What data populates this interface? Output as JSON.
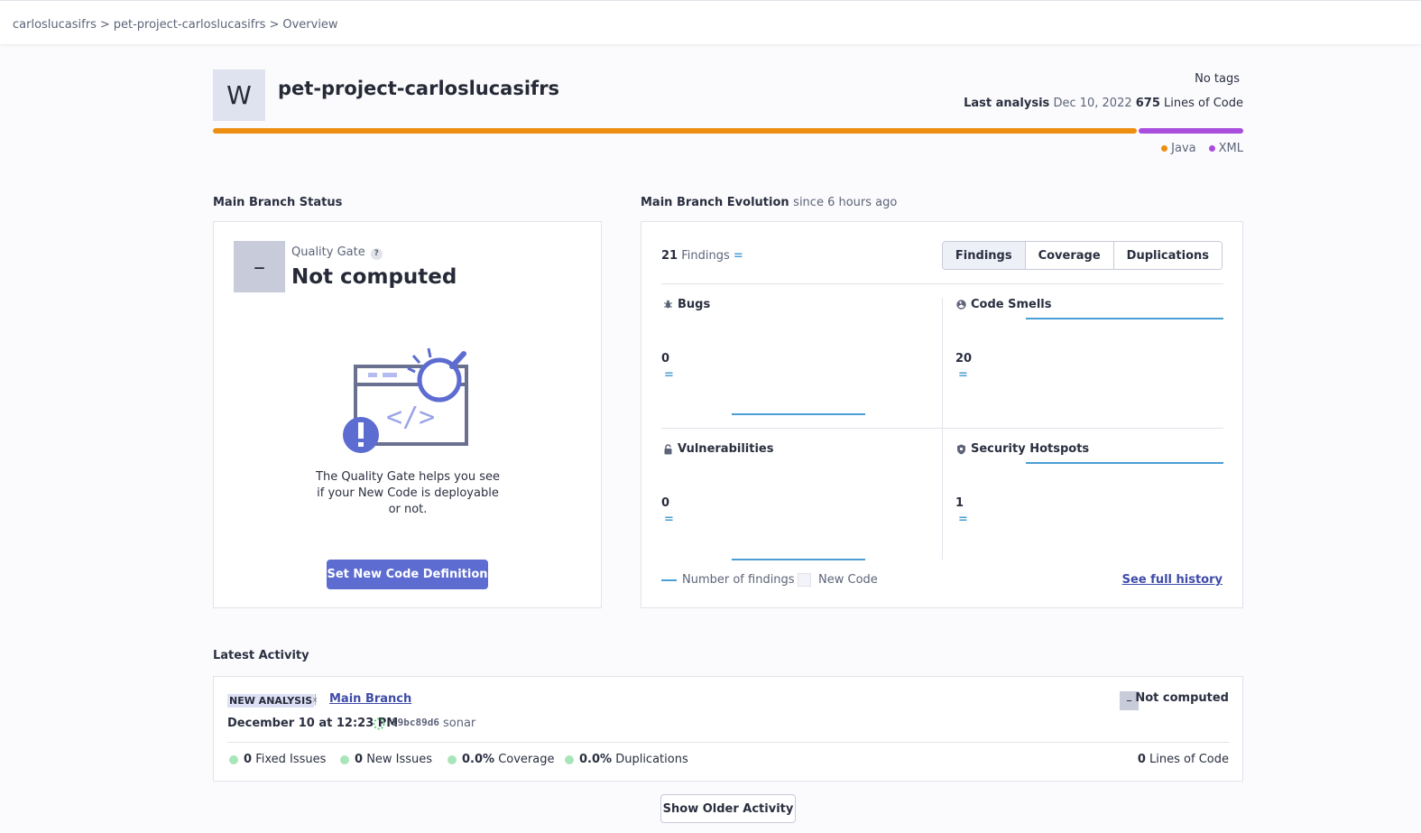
{
  "breadcrumb": {
    "items": [
      "carloslucasifrs",
      "pet-project-carloslucasifrs",
      "Overview"
    ],
    "separator": ">"
  },
  "project": {
    "avatar_letter": "W",
    "name": "pet-project-carloslucasifrs",
    "tags": "No tags",
    "last_analysis_label": "Last analysis",
    "last_analysis_date": "Dec 10, 2022",
    "loc_count": "675",
    "loc_label": "Lines of Code"
  },
  "languages": [
    {
      "name": "Java",
      "color": "#ed8e11",
      "fraction": 0.898
    },
    {
      "name": "XML",
      "color": "#a94ddc",
      "fraction": 0.102
    }
  ],
  "main_status": {
    "section_title": "Main Branch Status",
    "qg_symbol": "–",
    "qg_label": "Quality Gate",
    "qg_help": "?",
    "qg_value": "Not computed",
    "description": "The Quality Gate helps you see if your New Code is deployable or not.",
    "button_label": "Set New Code Definition"
  },
  "evolution": {
    "section_title": "Main Branch Evolution",
    "since": "since 6 hours ago",
    "findings_count": "21",
    "findings_label": "Findings",
    "eq_symbol": "=",
    "tabs": [
      {
        "label": "Findings",
        "active": true
      },
      {
        "label": "Coverage",
        "active": false
      },
      {
        "label": "Duplications",
        "active": false
      }
    ],
    "metrics": [
      {
        "title": "Bugs",
        "icon": "bug-icon",
        "value": "0"
      },
      {
        "title": "Code Smells",
        "icon": "code-smell-icon",
        "value": "20"
      },
      {
        "title": "Vulnerabilities",
        "icon": "lock-icon",
        "value": "0"
      },
      {
        "title": "Security Hotspots",
        "icon": "shield-icon",
        "value": "1"
      }
    ],
    "legend_findings": "Number of findings",
    "legend_new_code": "New Code",
    "history_link": "See full history"
  },
  "activity": {
    "section_title": "Latest Activity",
    "badge": "NEW ANALYSIS",
    "branch_icon": "ᚼ",
    "branch": "Main Branch",
    "status_symbol": "–",
    "status": "Not computed",
    "date": "December 10 at 12:23 PM",
    "hash": "19bc89d6",
    "user": "sonar",
    "stats": [
      {
        "value": "0",
        "label": "Fixed Issues"
      },
      {
        "value": "0",
        "label": "New Issues"
      },
      {
        "value": "0.0%",
        "label": "Coverage"
      },
      {
        "value": "0.0%",
        "label": "Duplications"
      }
    ],
    "loc_value": "0",
    "loc_label": "Lines of Code",
    "older_button": "Show Older Activity"
  },
  "colors": {
    "accent": "#5d6cd0",
    "link": "#3e4ba8",
    "chart_line": "#4b9fd5",
    "passed_dot": "#a8e5b9"
  }
}
